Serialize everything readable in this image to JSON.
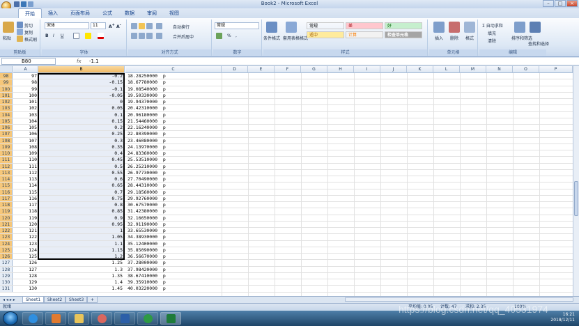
{
  "window": {
    "title": "Book2 - Microsoft Excel",
    "min": "–",
    "max": "□",
    "close": "×"
  },
  "tabs": [
    "开始",
    "插入",
    "页面布局",
    "公式",
    "数据",
    "审阅",
    "视图"
  ],
  "ribbon": {
    "clipboard": {
      "label": "剪贴板",
      "paste": "粘贴",
      "cut": "剪切",
      "copy": "复制",
      "format_painter": "格式刷"
    },
    "font": {
      "label": "字体",
      "name": "宋体",
      "size": "11",
      "bold": "B",
      "italic": "I",
      "underline": "U"
    },
    "alignment": {
      "label": "对齐方式",
      "wrap": "自动换行",
      "merge": "合并后居中"
    },
    "number": {
      "label": "数字",
      "format": "常规",
      "percent": "%",
      "comma": ","
    },
    "styles": {
      "label": "样式",
      "conditional": "条件格式",
      "table": "套用表格格式",
      "cells": [
        {
          "text": "常规",
          "bg": "#ffffff",
          "fg": "#000000"
        },
        {
          "text": "差",
          "bg": "#ffc7ce",
          "fg": "#9c0006"
        },
        {
          "text": "好",
          "bg": "#c6efce",
          "fg": "#006100"
        },
        {
          "text": "适中",
          "bg": "#ffeb9c",
          "fg": "#9c5700"
        },
        {
          "text": "计算",
          "bg": "#f2f2f2",
          "fg": "#fa7d00"
        },
        {
          "text": "检查单元格",
          "bg": "#a5a5a5",
          "fg": "#ffffff"
        }
      ]
    },
    "cells": {
      "label": "单元格",
      "insert": "插入",
      "delete": "删除",
      "format": "格式"
    },
    "editing": {
      "label": "编辑",
      "autosum": "Σ 自动求和",
      "fill": "填充",
      "clear": "清除",
      "sort": "排序和筛选",
      "find": "查找和选择"
    }
  },
  "formula_bar": {
    "name": "B80",
    "fx": "fx",
    "value": "-1.1"
  },
  "columns": [
    "A",
    "B",
    "C",
    "D",
    "E",
    "F",
    "G",
    "H",
    "I",
    "J",
    "K",
    "L",
    "M",
    "N",
    "O",
    "P"
  ],
  "rows": [
    {
      "n": "98",
      "a": "97",
      "b": "-0.2",
      "c": "18.28250000  p",
      "sel": true
    },
    {
      "n": "99",
      "a": "98",
      "b": "-0.15",
      "c": "18.67780000  p",
      "sel": true
    },
    {
      "n": "100",
      "a": "99",
      "b": "-0.1",
      "c": "19.08540000  p",
      "sel": true
    },
    {
      "n": "101",
      "a": "100",
      "b": "-0.05",
      "c": "19.50330000  p",
      "sel": true
    },
    {
      "n": "102",
      "a": "101",
      "b": "0",
      "c": "19.94370000  p",
      "sel": true
    },
    {
      "n": "103",
      "a": "102",
      "b": "0.05",
      "c": "20.42310000  p",
      "sel": true
    },
    {
      "n": "104",
      "a": "103",
      "b": "0.1",
      "c": "20.96180000  p",
      "sel": true
    },
    {
      "n": "105",
      "a": "104",
      "b": "0.15",
      "c": "21.54460000  p",
      "sel": true
    },
    {
      "n": "106",
      "a": "105",
      "b": "0.2",
      "c": "22.16240000  p",
      "sel": true
    },
    {
      "n": "107",
      "a": "106",
      "b": "0.25",
      "c": "22.80390000  p",
      "sel": true
    },
    {
      "n": "108",
      "a": "107",
      "b": "0.3",
      "c": "23.46080000  p",
      "sel": true
    },
    {
      "n": "109",
      "a": "108",
      "b": "0.35",
      "c": "24.13970000  p",
      "sel": true
    },
    {
      "n": "110",
      "a": "109",
      "b": "0.4",
      "c": "24.83360000  p",
      "sel": true
    },
    {
      "n": "111",
      "a": "110",
      "b": "0.45",
      "c": "25.53510000  p",
      "sel": true
    },
    {
      "n": "112",
      "a": "111",
      "b": "0.5",
      "c": "26.25210000  p",
      "sel": true
    },
    {
      "n": "113",
      "a": "112",
      "b": "0.55",
      "c": "26.97730000  p",
      "sel": true
    },
    {
      "n": "114",
      "a": "113",
      "b": "0.6",
      "c": "27.70490000  p",
      "sel": true
    },
    {
      "n": "115",
      "a": "114",
      "b": "0.65",
      "c": "28.44310000  p",
      "sel": true
    },
    {
      "n": "116",
      "a": "115",
      "b": "0.7",
      "c": "29.18560000  p",
      "sel": true
    },
    {
      "n": "117",
      "a": "116",
      "b": "0.75",
      "c": "29.92760000  p",
      "sel": true
    },
    {
      "n": "118",
      "a": "117",
      "b": "0.8",
      "c": "30.67570000  p",
      "sel": true
    },
    {
      "n": "119",
      "a": "118",
      "b": "0.85",
      "c": "31.42380000  p",
      "sel": true
    },
    {
      "n": "120",
      "a": "119",
      "b": "0.9",
      "c": "32.16650000  p",
      "sel": true
    },
    {
      "n": "121",
      "a": "120",
      "b": "0.95",
      "c": "32.91190000  p",
      "sel": true
    },
    {
      "n": "122",
      "a": "121",
      "b": "1",
      "c": "33.65530000  p",
      "sel": true
    },
    {
      "n": "123",
      "a": "122",
      "b": "1.05",
      "c": "34.38930000  p",
      "sel": true
    },
    {
      "n": "124",
      "a": "123",
      "b": "1.1",
      "c": "35.12400000  p",
      "sel": true
    },
    {
      "n": "125",
      "a": "124",
      "b": "1.15",
      "c": "35.85090000  p",
      "sel": true
    },
    {
      "n": "126",
      "a": "125",
      "b": "1.2",
      "c": "36.56670000  p",
      "sel": true
    },
    {
      "n": "127",
      "a": "126",
      "b": "1.25",
      "c": "37.28000000  p",
      "sel": false
    },
    {
      "n": "128",
      "a": "127",
      "b": "1.3",
      "c": "37.98420000  p",
      "sel": false
    },
    {
      "n": "129",
      "a": "128",
      "b": "1.35",
      "c": "38.67410000  p",
      "sel": false
    },
    {
      "n": "130",
      "a": "129",
      "b": "1.4",
      "c": "39.35910000  p",
      "sel": false
    },
    {
      "n": "131",
      "a": "130",
      "b": "1.45",
      "c": "40.03220000  p",
      "sel": false
    }
  ],
  "sheets": [
    "Sheet1",
    "Sheet2",
    "Sheet3"
  ],
  "status": {
    "ready": "就绪",
    "average": "平均值: 0.05",
    "count": "计数: 47",
    "sum": "求和: 2.35",
    "zoom": "100%"
  },
  "taskbar": {
    "time": "16:21",
    "date": "2018/12/11"
  },
  "watermark": "https://blog.csdn.net/qq_40531974"
}
